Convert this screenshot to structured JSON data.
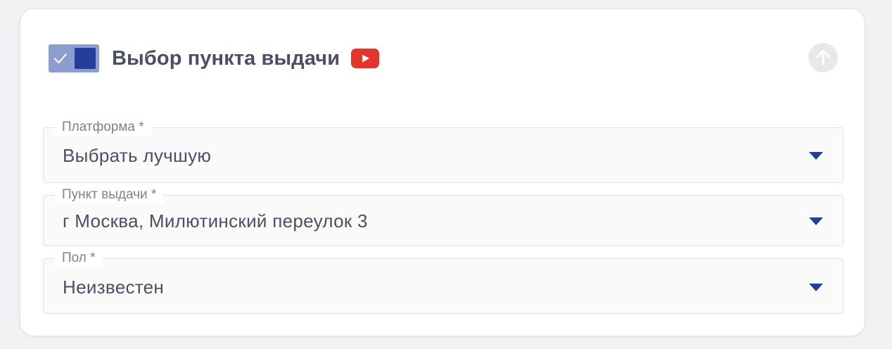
{
  "section": {
    "title": "Выбор пункта выдачи",
    "toggle_enabled": true,
    "icons": {
      "toggle_check": "check-icon",
      "video": "youtube-icon",
      "collapse": "arrow-up-icon",
      "dropdown": "caret-down-icon"
    },
    "colors": {
      "toggle_track": "#8e9dcf",
      "toggle_knob": "#233e9c",
      "youtube": "#e5342c",
      "caret": "#233e9c"
    }
  },
  "fields": {
    "platform": {
      "label": "Платформа *",
      "value": "Выбрать лучшую"
    },
    "pickup_point": {
      "label": "Пункт выдачи *",
      "value": "г Москва, Милютинский переулок 3"
    },
    "gender": {
      "label": "Пол *",
      "value": "Неизвестен"
    }
  }
}
